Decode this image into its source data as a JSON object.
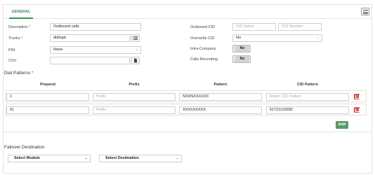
{
  "tabs": {
    "general": "GENERAL"
  },
  "form": {
    "description_label": "Description",
    "description_value": "Outbound calls",
    "trunks_label": "Trunks",
    "trunks_value": "didlogic",
    "pin_label": "PIN",
    "pin_value": "None",
    "csv_label": "CSV",
    "csv_value": "",
    "outbound_cid_label": "Outbound CID",
    "cid_name_placeholder": "CID Name",
    "cid_number_placeholder": "CID Number",
    "overwrite_cid_label": "Overwrite CID",
    "overwrite_cid_value": "No",
    "intra_company_label": "Intra-Company",
    "intra_company_value": "No",
    "calls_recording_label": "Calls Recording",
    "calls_recording_value": "No",
    "required_mark": "*"
  },
  "dial_patterns": {
    "title": "Dial Patterns",
    "columns": [
      "Prepend",
      "Prefix",
      "Pattern",
      "CID Pattern"
    ],
    "prefix_placeholder": "Prefix",
    "cid_pattern_placeholder": "Match CID Pattern",
    "rows": [
      {
        "prepend": "1",
        "prefix": "",
        "pattern": "NXXNXXXXXX",
        "cid_pattern": ""
      },
      {
        "prepend": "61",
        "prefix": "",
        "pattern": "XXXXXXXXX",
        "cid_pattern": "61721119282"
      }
    ],
    "add_label": "Add"
  },
  "failover": {
    "title": "Failover Destination",
    "module_label": "Select Module",
    "destination_label": "Select Destination"
  },
  "colors": {
    "accent": "#3a8c5a",
    "add_button": "#5a9a6a",
    "danger": "#d9534f"
  }
}
